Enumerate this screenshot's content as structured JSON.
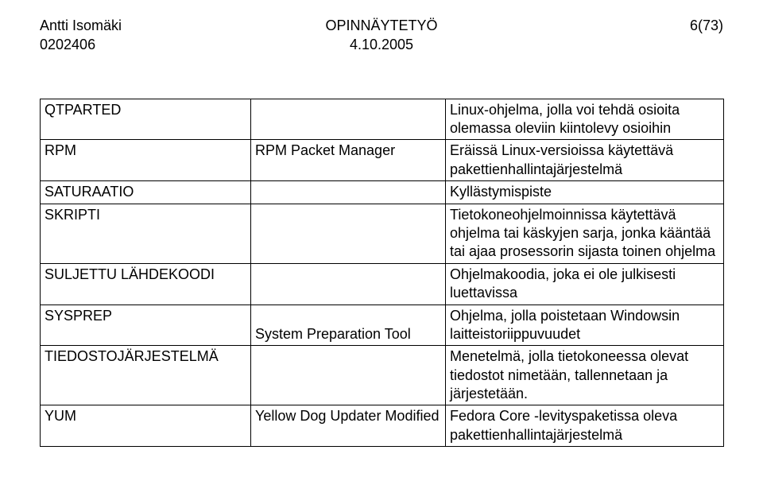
{
  "header": {
    "authorName": "Antti Isomäki",
    "authorId": "0202406",
    "docTitle": "OPINNÄYTETYÖ",
    "docDate": "4.10.2005",
    "pageNum": "6(73)"
  },
  "rows": [
    {
      "term": "QTPARTED",
      "abbr": "",
      "definition": "Linux-ohjelma, jolla voi tehdä osioita olemassa oleviin kiintolevy osioihin"
    },
    {
      "term": "RPM",
      "abbr": "RPM Packet Manager",
      "definition": "Eräissä Linux-versioissa käytettävä pakettienhallintajärjestelmä"
    },
    {
      "term": "SATURAATIO",
      "abbr": "",
      "definition": "Kyllästymispiste"
    },
    {
      "term": "SKRIPTI",
      "abbr": "",
      "definition": "Tietokoneohjelmoinnissa käytettävä ohjelma tai käskyjen sarja, jonka kääntää tai ajaa prosessorin sijasta toinen ohjelma"
    },
    {
      "term": "SULJETTU LÄHDEKOODI",
      "abbr": "",
      "definition": "Ohjelmakoodia, joka ei ole julkisesti luettavissa"
    },
    {
      "term": "SYSPREP",
      "abbr": "System Preparation Tool",
      "definition": "Ohjelma, jolla poistetaan Windowsin laitteistoriippuvuudet"
    },
    {
      "term": "TIEDOSTOJÄRJESTELMÄ",
      "abbr": "",
      "definition": "Menetelmä, jolla tietokoneessa olevat tiedostot nimetään, tallennetaan ja järjestetään."
    },
    {
      "term": "YUM",
      "abbr": "Yellow Dog Updater Modified",
      "definition": "Fedora Core -levityspaketissa oleva pakettienhallintajärjestelmä"
    }
  ]
}
